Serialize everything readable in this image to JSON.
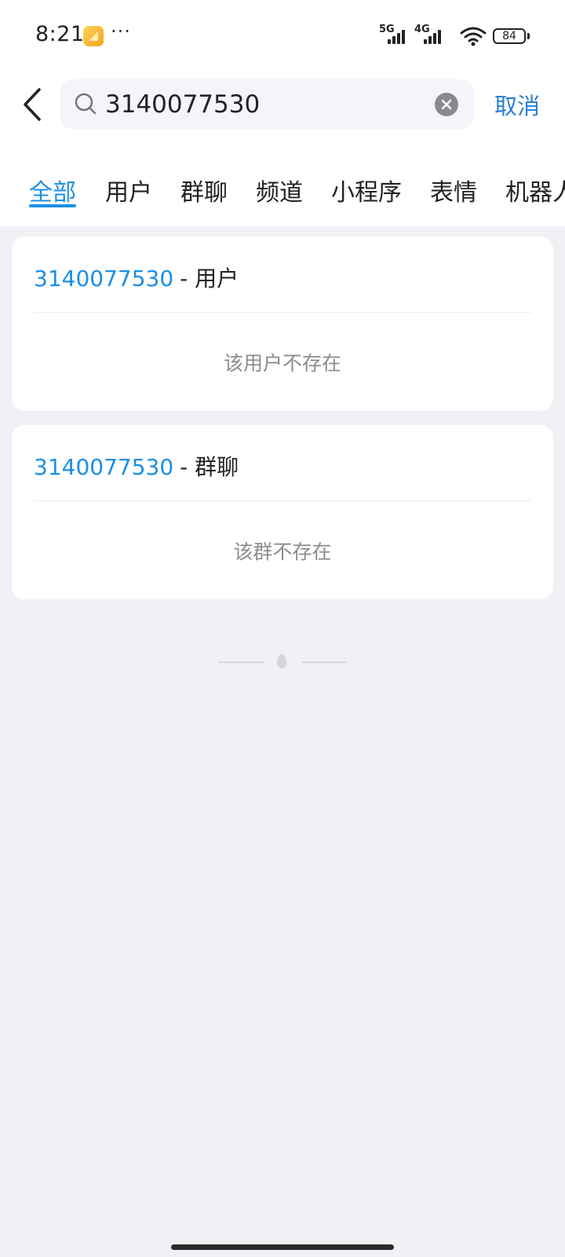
{
  "status_bar": {
    "time": "8:21",
    "app_icon": "notes-app-icon",
    "more": "···",
    "network_primary": "5G",
    "network_secondary": "4G",
    "battery": "84"
  },
  "search": {
    "query": "3140077530",
    "cancel_label": "取消"
  },
  "tabs": [
    {
      "label": "全部",
      "active": true
    },
    {
      "label": "用户",
      "active": false
    },
    {
      "label": "群聊",
      "active": false
    },
    {
      "label": "频道",
      "active": false
    },
    {
      "label": "小程序",
      "active": false
    },
    {
      "label": "表情",
      "active": false
    },
    {
      "label": "机器人",
      "active": false
    }
  ],
  "results": [
    {
      "id": "3140077530",
      "type": "- 用户",
      "empty_text": "该用户不存在"
    },
    {
      "id": "3140077530",
      "type": "- 群聊",
      "empty_text": "该群不存在"
    }
  ],
  "colors": {
    "accent": "#1c8fe6",
    "cancel": "#2a7fd4",
    "background": "#f0f0f5"
  },
  "icons": {
    "back": "chevron-left-icon",
    "search": "search-icon",
    "clear": "clear-icon",
    "wifi": "wifi-icon",
    "footer": "penguin-icon"
  }
}
